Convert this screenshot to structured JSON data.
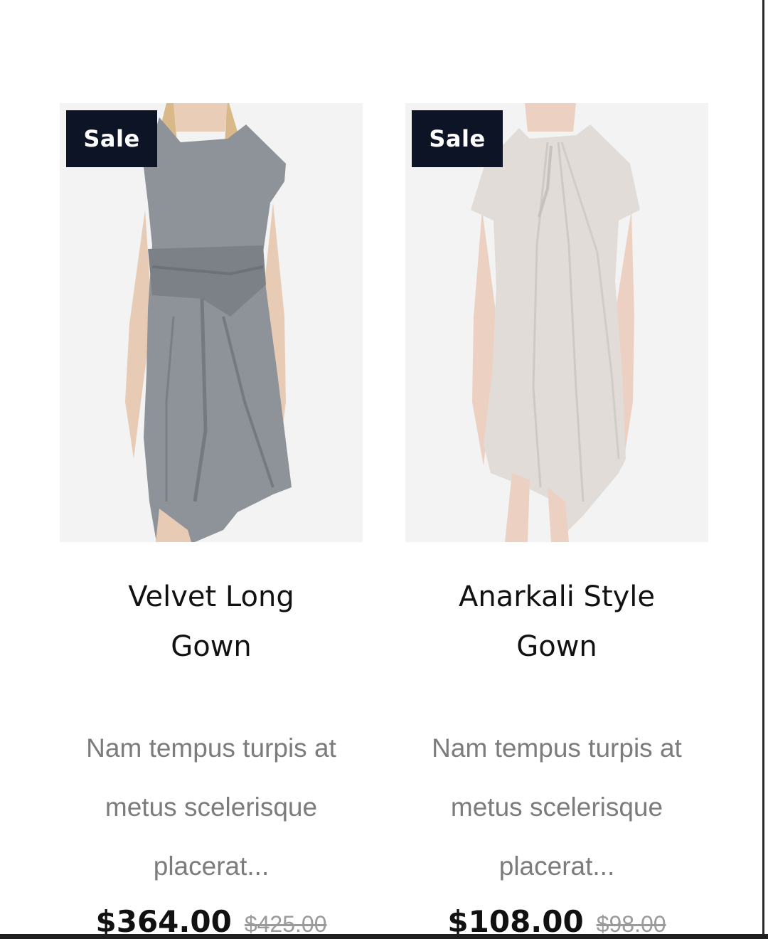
{
  "products": [
    {
      "badge": "Sale",
      "title": "Velvet Long Gown",
      "description": "Nam tempus turpis at metus scelerisque placerat...",
      "price": "$364.00",
      "old_price": "$425.00",
      "dress_color": "#8e9399"
    },
    {
      "badge": "Sale",
      "title": "Anarkali Style Gown",
      "description": "Nam tempus turpis at metus scelerisque placerat...",
      "price": "$108.00",
      "old_price": "$98.00",
      "dress_color": "#e1dcd8"
    }
  ],
  "colors": {
    "badge_bg": "#0d1426",
    "title": "#111111",
    "description": "#7c7c7c",
    "old_price": "#9a9a9a"
  }
}
